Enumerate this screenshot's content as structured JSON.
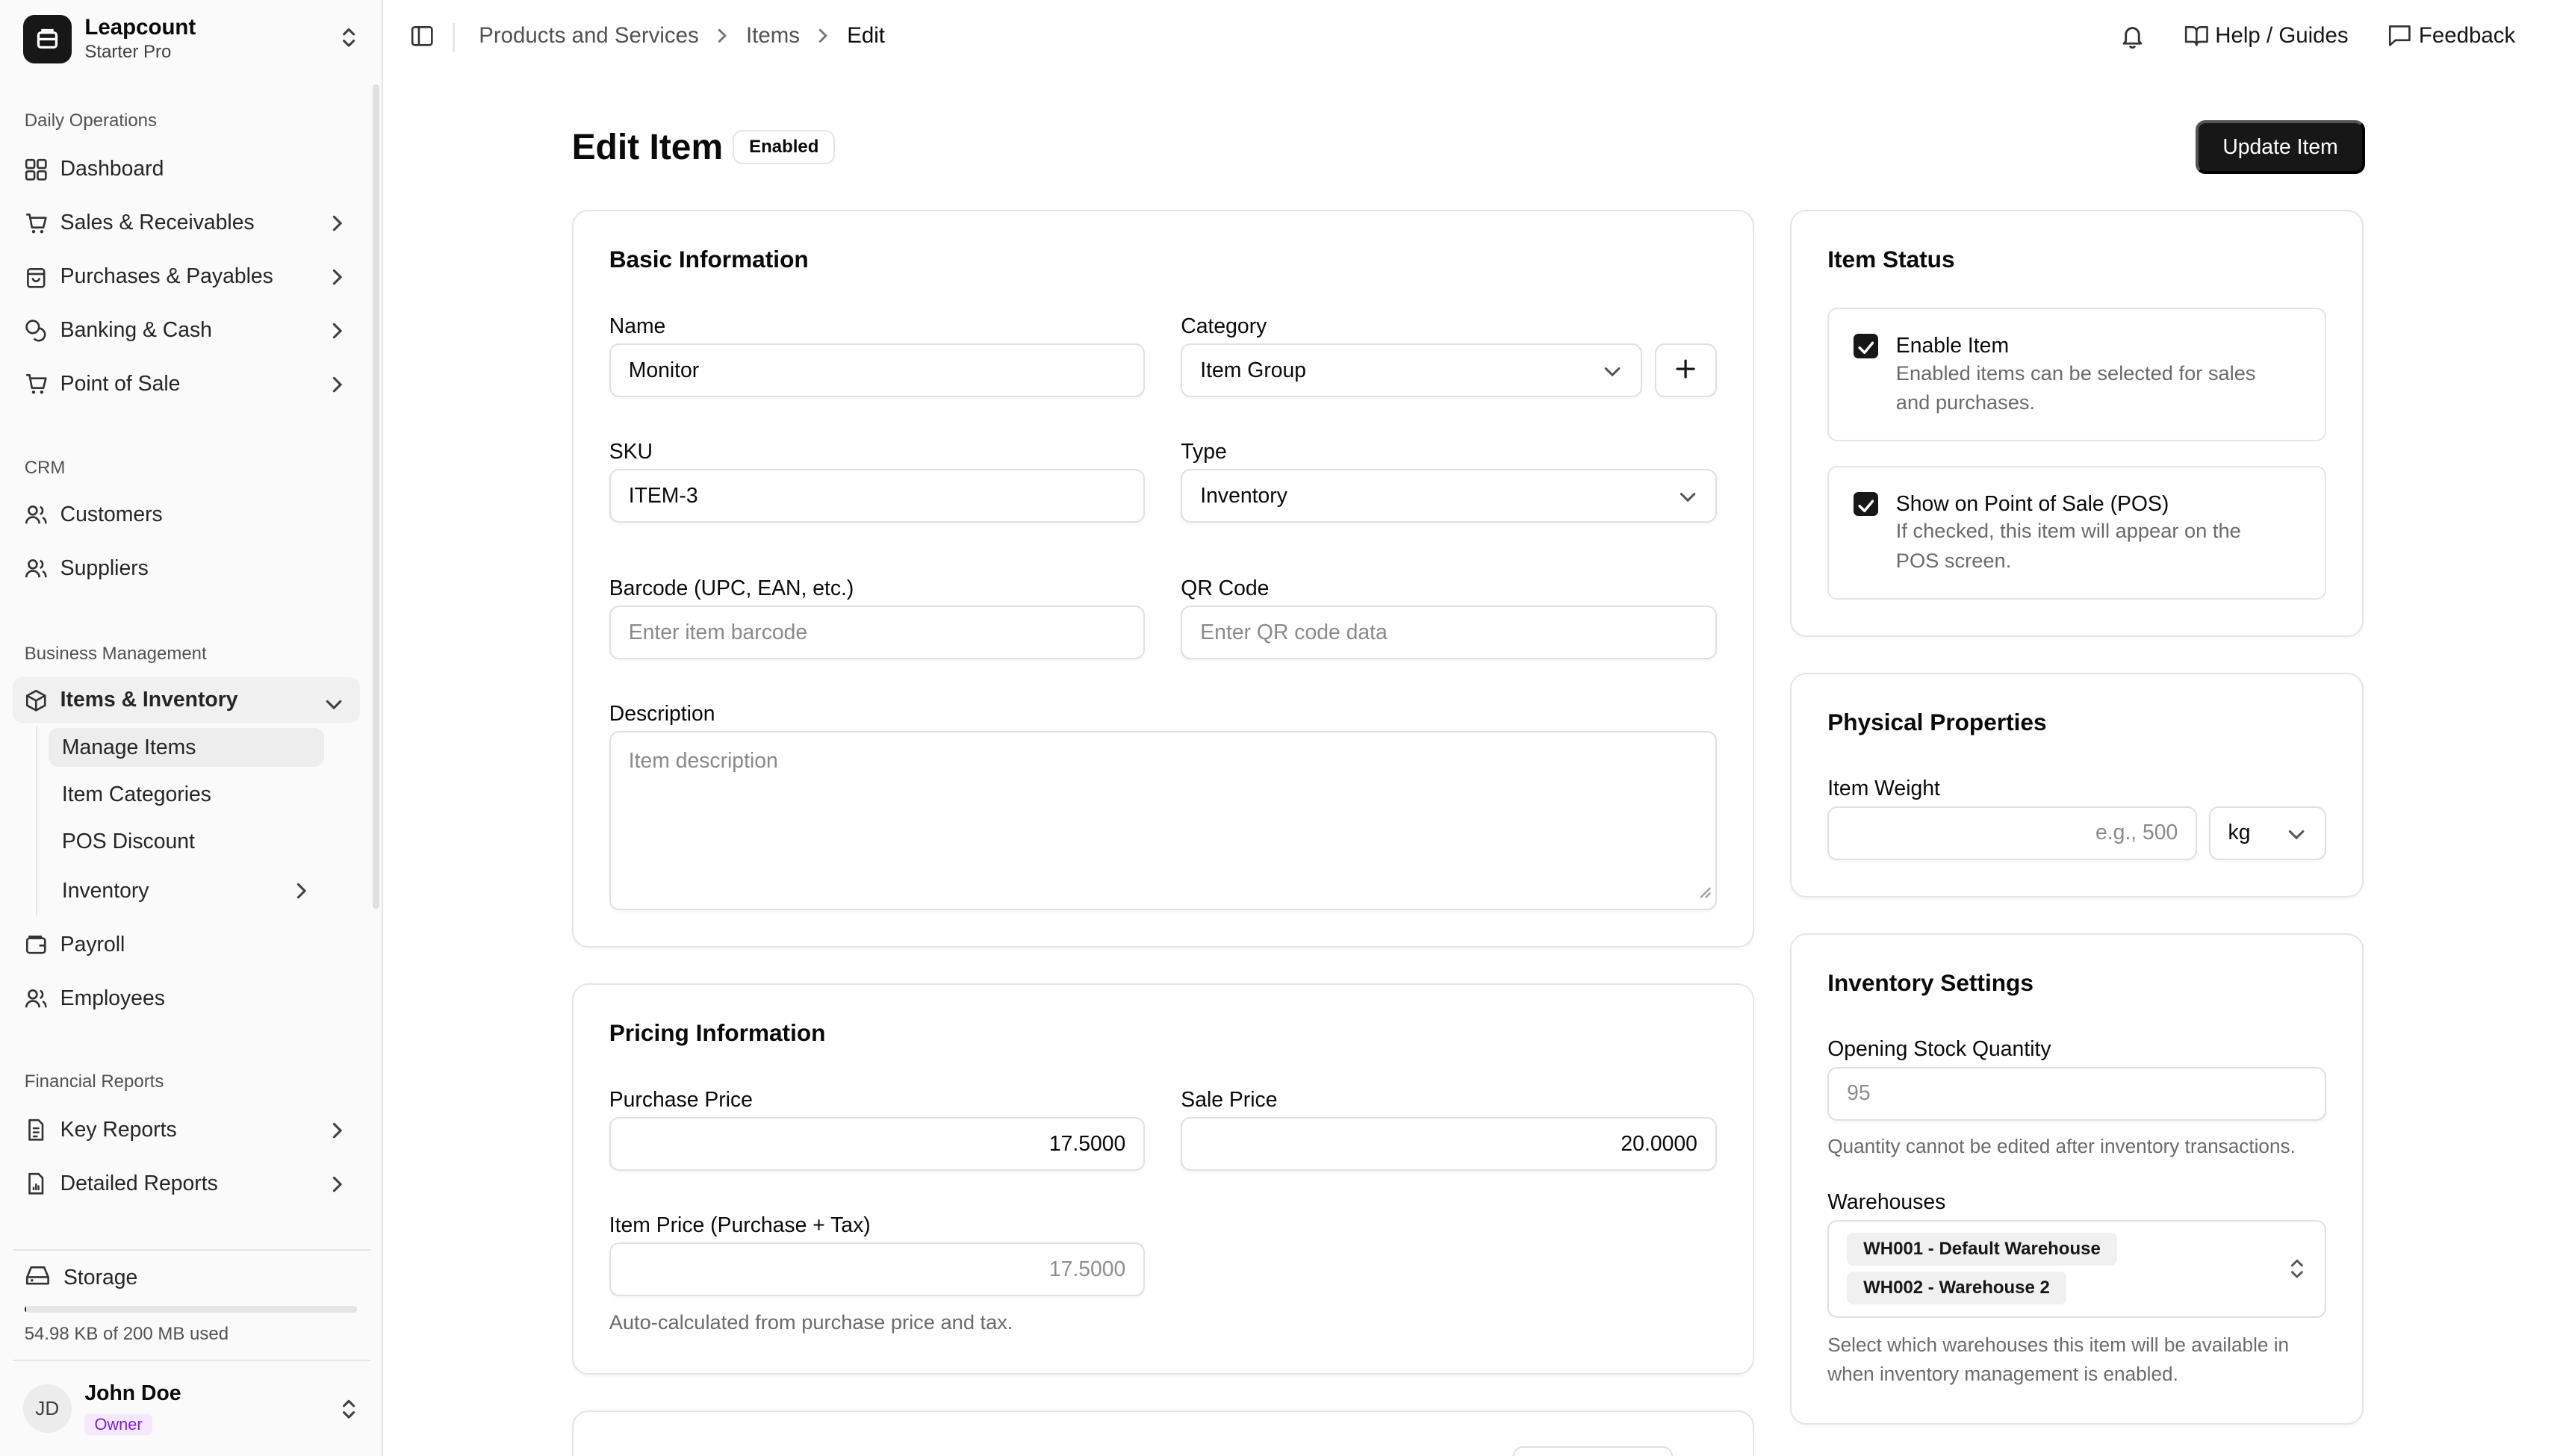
{
  "app": {
    "name": "Leapcount",
    "plan": "Starter Pro"
  },
  "sidebar": {
    "groups": [
      {
        "label": "Daily Operations",
        "items": [
          "Dashboard",
          "Sales & Receivables",
          "Purchases & Payables",
          "Banking & Cash",
          "Point of Sale"
        ]
      },
      {
        "label": "CRM",
        "items": [
          "Customers",
          "Suppliers"
        ]
      },
      {
        "label": "Business Management",
        "items": [
          "Items & Inventory",
          "Payroll",
          "Employees"
        ]
      },
      {
        "label": "Financial Reports",
        "items": [
          "Key Reports",
          "Detailed Reports"
        ]
      }
    ],
    "sub_items": [
      "Manage Items",
      "Item Categories",
      "POS Discount",
      "Inventory"
    ],
    "storage": {
      "label": "Storage",
      "used_text": "54.98 KB of 200 MB used",
      "fraction": 0.0003
    },
    "user": {
      "initials": "JD",
      "name": "John Doe",
      "role": "Owner"
    }
  },
  "topbar": {
    "breadcrumbs": [
      "Products and Services",
      "Items",
      "Edit"
    ],
    "help_label": "Help / Guides",
    "feedback_label": "Feedback"
  },
  "page": {
    "title": "Edit Item",
    "badge": "Enabled",
    "update_button": "Update Item"
  },
  "basic": {
    "title": "Basic Information",
    "name_label": "Name",
    "name_value": "Monitor",
    "category_label": "Category",
    "category_value": "Item Group",
    "sku_label": "SKU",
    "sku_value": "ITEM-3",
    "type_label": "Type",
    "type_value": "Inventory",
    "barcode_label": "Barcode (UPC, EAN, etc.)",
    "barcode_placeholder": "Enter item barcode",
    "qr_label": "QR Code",
    "qr_placeholder": "Enter QR code data",
    "desc_label": "Description",
    "desc_placeholder": "Item description"
  },
  "pricing": {
    "title": "Pricing Information",
    "purchase_label": "Purchase Price",
    "purchase_value": "17.5000",
    "sale_label": "Sale Price",
    "sale_value": "20.0000",
    "item_price_label": "Item Price (Purchase + Tax)",
    "item_price_value": "17.5000",
    "help": "Auto-calculated from purchase price and tax."
  },
  "status": {
    "title": "Item Status",
    "enable_title": "Enable Item",
    "enable_desc_1": "Enabled items can be selected for sales",
    "enable_desc_2": "and purchases.",
    "pos_title": "Show on Point of Sale (POS)",
    "pos_desc_1": "If checked, this item will appear on the",
    "pos_desc_2": "POS screen."
  },
  "physical": {
    "title": "Physical Properties",
    "weight_label": "Item Weight",
    "weight_placeholder": "e.g., 500",
    "unit": "kg"
  },
  "inventory": {
    "title": "Inventory Settings",
    "opening_label": "Opening Stock Quantity",
    "opening_value": "95",
    "opening_help": "Quantity cannot be edited after inventory transactions.",
    "warehouses_label": "Warehouses",
    "warehouses": [
      "WH001 - Default Warehouse",
      "WH002 - Warehouse 2"
    ],
    "wh_help_1": "Select which warehouses this item will be available in",
    "wh_help_2": "when inventory management is enabled."
  },
  "colors": {
    "primary": "#171717",
    "owner_badge": "#7e22ce"
  }
}
